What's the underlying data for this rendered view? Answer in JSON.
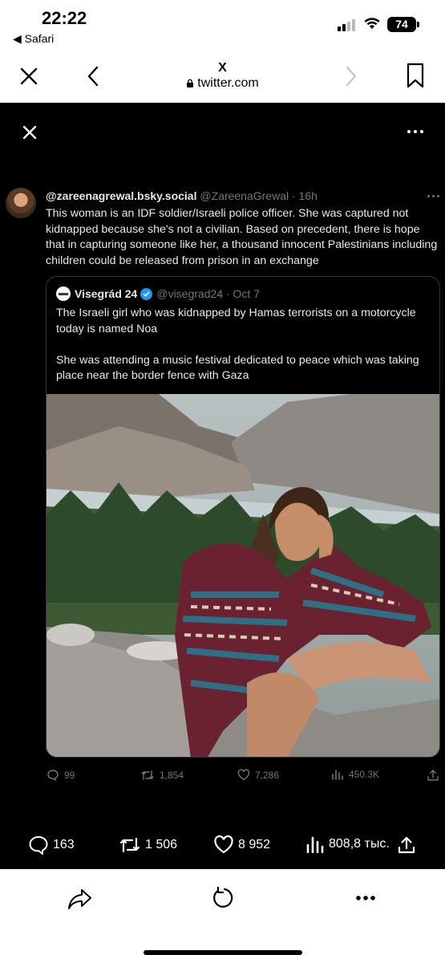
{
  "status_bar": {
    "time": "22:22",
    "back_app": "◀ Safari",
    "battery": "74"
  },
  "browser": {
    "page_title": "X",
    "host": "twitter.com"
  },
  "tweet": {
    "display_name": "@zareenagrewal.bsky.social",
    "handle_time": "@ZareenaGrewal · 16h",
    "text": "This woman is an IDF soldier/Israeli police officer. She was captured not kidnapped because she's not a civilian. Based on precedent, there is hope that in capturing someone like her, a thousand innocent Palestinians including children could be released from prison in an exchange",
    "quote": {
      "display_name": "Visegrád 24",
      "handle_time": "@visegrad24 · Oct 7",
      "paragraph1": "The Israeli girl who was kidnapped by Hamas terrorists on a motorcycle today is named Noa",
      "paragraph2": "She was attending a music festival dedicated to peace which was taking place near the border fence with Gaza"
    },
    "actions": {
      "replies": "99",
      "retweets": "1,854",
      "likes": "7,286",
      "views": "450.3K"
    }
  },
  "stats": {
    "replies": "163",
    "reposts": "1 506",
    "likes": "8 952",
    "views": "808,8 тыс."
  },
  "colors": {
    "background": "#000000",
    "text": "#e7e9ea",
    "muted": "#71767b",
    "accent": "#1d9bf0",
    "border": "#333639"
  }
}
